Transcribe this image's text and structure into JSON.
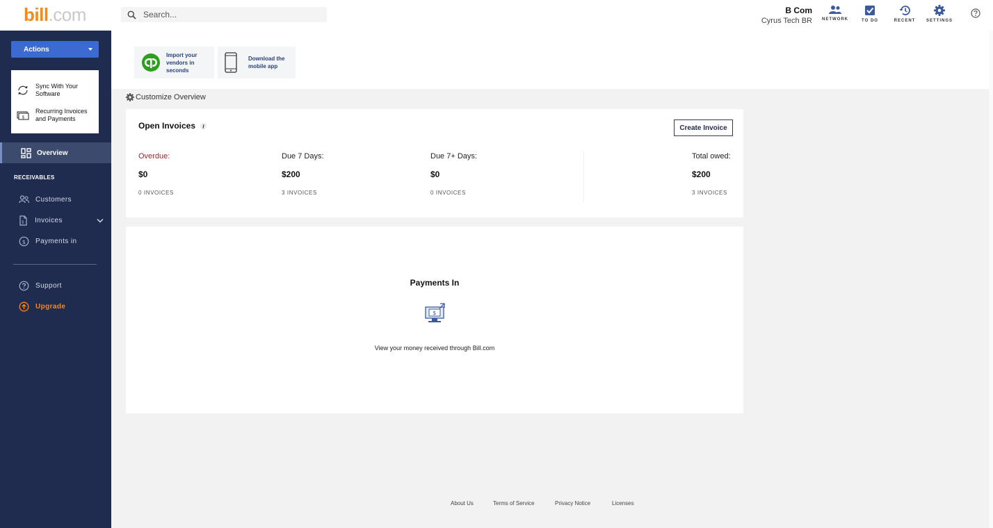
{
  "header": {
    "logo_bold": "bill",
    "logo_light": ".com",
    "search_placeholder": "Search...",
    "user_name": "B Com",
    "user_org": "Cyrus Tech BR",
    "nav": [
      {
        "label": "NETWORK",
        "icon": "network-icon"
      },
      {
        "label": "TO DO",
        "icon": "todo-icon"
      },
      {
        "label": "RECENT",
        "icon": "recent-icon"
      },
      {
        "label": "SETTINGS",
        "icon": "settings-icon"
      }
    ],
    "help_icon": "help-icon"
  },
  "sidebar": {
    "actions_label": "Actions",
    "action_menu": [
      {
        "label": "Sync With Your Software",
        "icon": "sync-icon"
      },
      {
        "label": "Recurring Invoices and Payments",
        "icon": "recurring-icon"
      }
    ],
    "overview_label": "Overview",
    "section_label": "RECEIVABLES",
    "items": [
      {
        "label": "Customers",
        "icon": "customers-icon"
      },
      {
        "label": "Invoices",
        "icon": "invoices-icon"
      },
      {
        "label": "Payments in",
        "icon": "payments-icon"
      }
    ],
    "bottom_items": [
      {
        "label": "Support",
        "icon": "support-icon"
      },
      {
        "label": "Upgrade",
        "icon": "upgrade-icon"
      }
    ],
    "accent_color": "#f28a1e"
  },
  "promos": [
    {
      "text": "Import your vendors in seconds",
      "icon": "quickbooks-icon"
    },
    {
      "text": "Download the mobile app",
      "icon": "phone-icon"
    }
  ],
  "customize_label": "Customize Overview",
  "open_invoices": {
    "title": "Open Invoices",
    "create_label": "Create Invoice",
    "metrics": [
      {
        "label": "Overdue:",
        "value": "$0",
        "count": "0 INVOICES"
      },
      {
        "label": "Due 7 Days:",
        "value": "$200",
        "count": "3 INVOICES"
      },
      {
        "label": "Due 7+ Days:",
        "value": "$0",
        "count": "0 INVOICES"
      },
      {
        "label": "Total owed:",
        "value": "$200",
        "count": "3 INVOICES"
      }
    ]
  },
  "payments_in": {
    "title": "Payments In",
    "description": "View your money received through Bill.com"
  },
  "footer": {
    "links": [
      "About Us",
      "Terms of Service",
      "Privacy Notice",
      "Licenses"
    ]
  }
}
